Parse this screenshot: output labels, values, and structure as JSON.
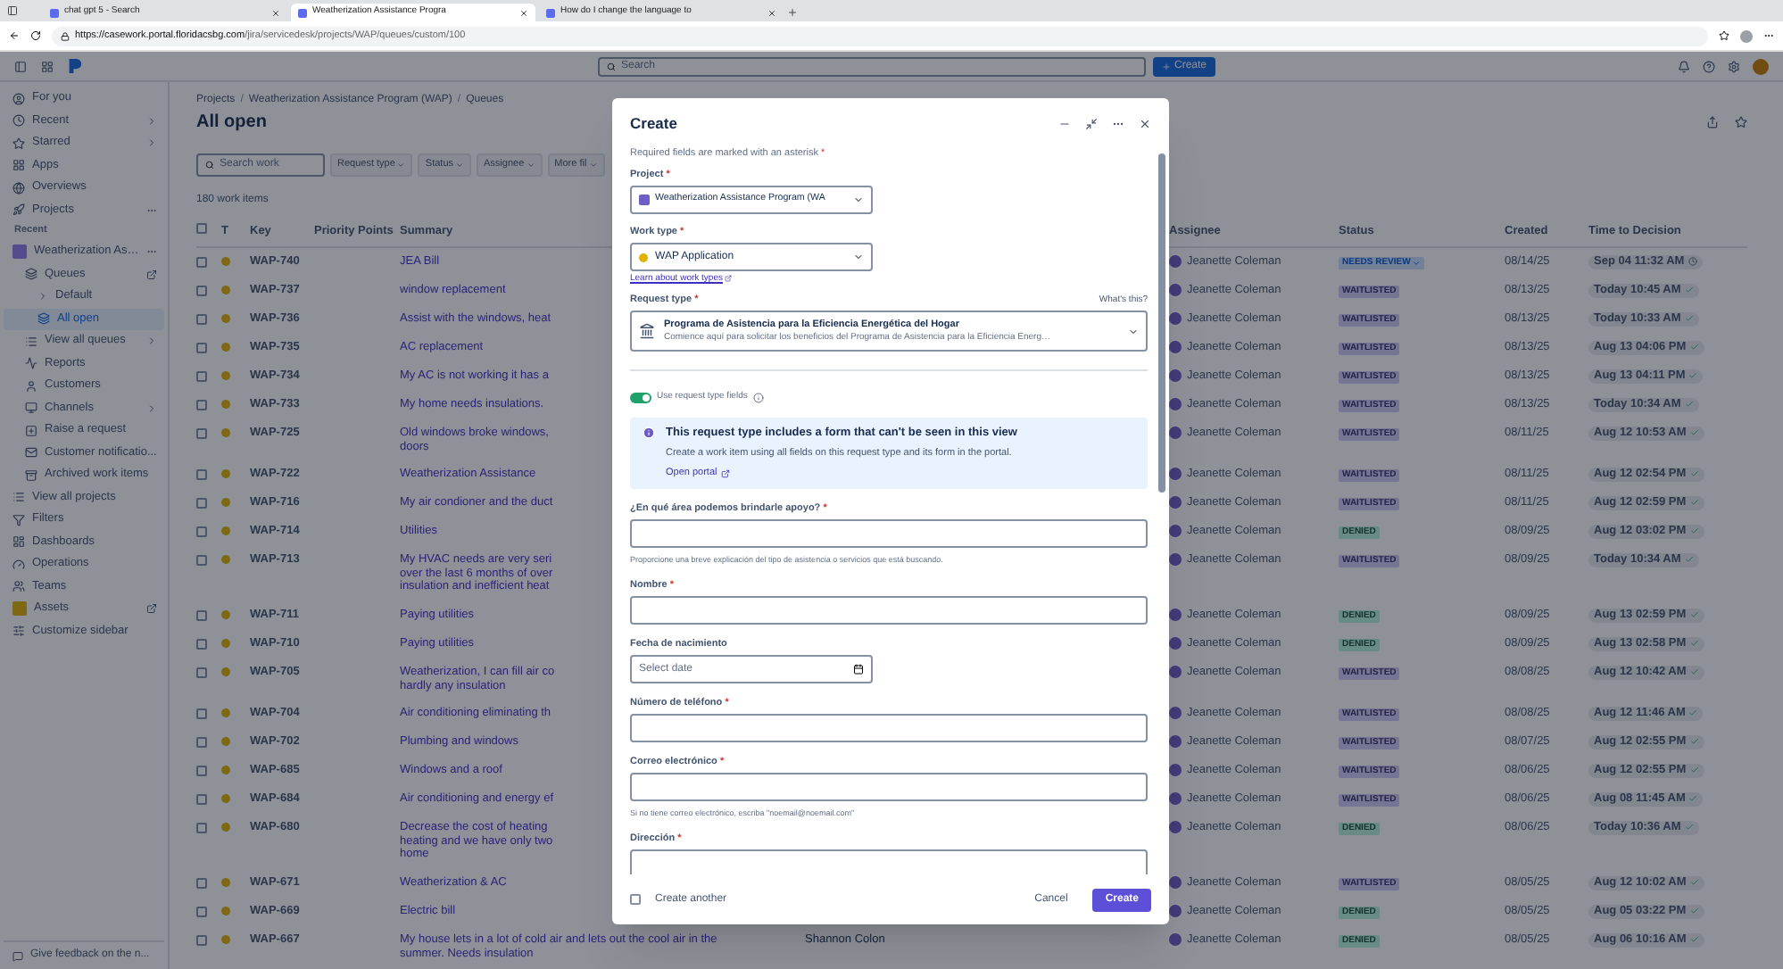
{
  "browser": {
    "tabs": [
      {
        "title": "chat gpt 5 - Search",
        "selected": false
      },
      {
        "title": "Weatherization Assistance Progra",
        "selected": true
      },
      {
        "title": "How do I change the language to",
        "selected": false
      }
    ],
    "url_host": "https://casework.portal.floridacsbg.com",
    "url_path": "/jira/servicedesk/projects/WAP/queues/custom/100"
  },
  "topnav": {
    "search_placeholder": "Search",
    "create_label": "Create"
  },
  "sidebar": {
    "items": [
      {
        "label": "For you",
        "kind": "nav",
        "selected": false
      },
      {
        "label": "Recent",
        "kind": "nav",
        "submenu": true,
        "selected": false
      },
      {
        "label": "Starred",
        "kind": "nav",
        "submenu": true,
        "selected": false
      },
      {
        "label": "Apps",
        "kind": "nav",
        "selected": false
      },
      {
        "label": "Overviews",
        "kind": "nav",
        "selected": false
      },
      {
        "label": "Projects",
        "kind": "nav",
        "more_menu": true,
        "selected": false
      },
      {
        "label": "Recent",
        "kind": "section"
      },
      {
        "label": "Weatherization As…",
        "kind": "project",
        "more_menu": true,
        "selected": false,
        "children": [
          {
            "label": "Queues",
            "kind": "nav",
            "external": true,
            "selected": false,
            "children": [
              {
                "label": "Default",
                "kind": "folder",
                "expanded": false,
                "selected": false
              },
              {
                "label": "All open",
                "kind": "nav",
                "selected": true
              }
            ]
          },
          {
            "label": "View all queues",
            "kind": "nav",
            "submenu": true,
            "selected": false
          },
          {
            "label": "Reports",
            "kind": "nav",
            "selected": false
          },
          {
            "label": "Customers",
            "kind": "nav",
            "selected": false
          },
          {
            "label": "Channels",
            "kind": "nav",
            "submenu": true,
            "selected": false
          },
          {
            "label": "Raise a request",
            "kind": "nav",
            "selected": false
          },
          {
            "label": "Customer notificatio...",
            "kind": "nav",
            "selected": false
          },
          {
            "label": "Archived work items",
            "kind": "nav",
            "selected": false
          }
        ]
      },
      {
        "label": "View all projects",
        "kind": "nav",
        "selected": false
      },
      {
        "label": "Filters",
        "kind": "nav",
        "selected": false
      },
      {
        "label": "Dashboards",
        "kind": "nav",
        "selected": false
      },
      {
        "label": "Operations",
        "kind": "nav",
        "selected": false
      },
      {
        "label": "Teams",
        "kind": "nav",
        "selected": false
      },
      {
        "label": "Assets",
        "kind": "app",
        "external": true,
        "selected": false
      },
      {
        "label": "Customize sidebar",
        "kind": "nav",
        "selected": false
      }
    ],
    "footer": "Give feedback on the n..."
  },
  "page": {
    "separator": "/",
    "breadcrumbs": [
      "Projects",
      "Weatherization Assistance Program (WAP)",
      "Queues"
    ],
    "title": "All open",
    "search_placeholder": "Search work",
    "filters": [
      "Request type",
      "Status",
      "Assignee",
      "More fil"
    ],
    "count": "180 work items"
  },
  "table": {
    "all_selected": false,
    "columns": [
      "T",
      "Key",
      "Priority Points",
      "Summary",
      "Assignee",
      "Status",
      "Created",
      "Time to Decision"
    ],
    "rows": [
      {
        "key": "WAP-740",
        "summary": [
          "JEA Bill"
        ],
        "assignee": "Jeanette Coleman",
        "status": {
          "label": "NEEDS REVIEW",
          "kind": "review"
        },
        "created": "08/14/25",
        "decision": {
          "label": "Sep 04 11:32 AM",
          "kind": "running"
        },
        "selected": false
      },
      {
        "key": "WAP-737",
        "summary": [
          "window replacement"
        ],
        "assignee": "Jeanette Coleman",
        "status": {
          "label": "WAITLISTED",
          "kind": "waitlisted"
        },
        "created": "08/13/25",
        "decision": {
          "label": "Today 10:45 AM",
          "kind": "met"
        },
        "selected": false
      },
      {
        "key": "WAP-736",
        "summary": [
          "Assist with the windows, heat"
        ],
        "assignee": "Jeanette Coleman",
        "status": {
          "label": "WAITLISTED",
          "kind": "waitlisted"
        },
        "created": "08/13/25",
        "decision": {
          "label": "Today 10:33 AM",
          "kind": "met"
        },
        "selected": false
      },
      {
        "key": "WAP-735",
        "summary": [
          "AC replacement"
        ],
        "assignee": "Jeanette Coleman",
        "status": {
          "label": "WAITLISTED",
          "kind": "waitlisted"
        },
        "created": "08/13/25",
        "decision": {
          "label": "Aug 13 04:06 PM",
          "kind": "met"
        },
        "selected": false
      },
      {
        "key": "WAP-734",
        "summary": [
          "My AC is not working it has a"
        ],
        "assignee": "Jeanette Coleman",
        "status": {
          "label": "WAITLISTED",
          "kind": "waitlisted"
        },
        "created": "08/13/25",
        "decision": {
          "label": "Aug 13 04:11 PM",
          "kind": "met"
        },
        "selected": false
      },
      {
        "key": "WAP-733",
        "summary": [
          "My home needs insulations."
        ],
        "assignee": "Jeanette Coleman",
        "status": {
          "label": "WAITLISTED",
          "kind": "waitlisted"
        },
        "created": "08/13/25",
        "decision": {
          "label": "Today 10:34 AM",
          "kind": "met"
        },
        "selected": false
      },
      {
        "key": "WAP-725",
        "summary": [
          "Old windows broke windows,",
          "doors"
        ],
        "assignee": "Jeanette Coleman",
        "status": {
          "label": "WAITLISTED",
          "kind": "waitlisted"
        },
        "created": "08/11/25",
        "decision": {
          "label": "Aug 12 10:53 AM",
          "kind": "met"
        },
        "selected": false
      },
      {
        "key": "WAP-722",
        "summary": [
          "Weatherization Assistance"
        ],
        "assignee": "Jeanette Coleman",
        "status": {
          "label": "WAITLISTED",
          "kind": "waitlisted"
        },
        "created": "08/11/25",
        "decision": {
          "label": "Aug 12 02:54 PM",
          "kind": "met"
        },
        "selected": false
      },
      {
        "key": "WAP-716",
        "summary": [
          "My air condioner and the duct"
        ],
        "assignee": "Jeanette Coleman",
        "status": {
          "label": "WAITLISTED",
          "kind": "waitlisted"
        },
        "created": "08/11/25",
        "decision": {
          "label": "Aug 12 02:59 PM",
          "kind": "met"
        },
        "selected": false
      },
      {
        "key": "WAP-714",
        "summary": [
          "Utilities"
        ],
        "assignee": "Jeanette Coleman",
        "status": {
          "label": "DENIED",
          "kind": "denied"
        },
        "created": "08/09/25",
        "decision": {
          "label": "Aug 12 03:02 PM",
          "kind": "met"
        },
        "selected": false
      },
      {
        "key": "WAP-713",
        "summary": [
          "My HVAC needs are very seri",
          "over the last 6 months of over",
          "insulation and inefficient heat"
        ],
        "assignee": "Jeanette Coleman",
        "status": {
          "label": "WAITLISTED",
          "kind": "waitlisted"
        },
        "created": "08/09/25",
        "decision": {
          "label": "Today 10:34 AM",
          "kind": "met"
        },
        "selected": false
      },
      {
        "key": "WAP-711",
        "summary": [
          "Paying utilities"
        ],
        "assignee": "Jeanette Coleman",
        "status": {
          "label": "DENIED",
          "kind": "denied"
        },
        "created": "08/09/25",
        "decision": {
          "label": "Aug 13 02:59 PM",
          "kind": "met"
        },
        "selected": false
      },
      {
        "key": "WAP-710",
        "summary": [
          "Paying utilities"
        ],
        "assignee": "Jeanette Coleman",
        "status": {
          "label": "DENIED",
          "kind": "denied"
        },
        "created": "08/09/25",
        "decision": {
          "label": "Aug 13 02:58 PM",
          "kind": "met"
        },
        "selected": false
      },
      {
        "key": "WAP-705",
        "summary": [
          "Weatherization, I can fill air co",
          "hardly any insulation"
        ],
        "assignee": "Jeanette Coleman",
        "status": {
          "label": "WAITLISTED",
          "kind": "waitlisted"
        },
        "created": "08/08/25",
        "decision": {
          "label": "Aug 12 10:42 AM",
          "kind": "met"
        },
        "selected": false
      },
      {
        "key": "WAP-704",
        "summary": [
          "Air conditioning eliminating th"
        ],
        "assignee": "Jeanette Coleman",
        "status": {
          "label": "WAITLISTED",
          "kind": "waitlisted"
        },
        "created": "08/08/25",
        "decision": {
          "label": "Aug 12 11:46 AM",
          "kind": "met"
        },
        "selected": false
      },
      {
        "key": "WAP-702",
        "summary": [
          "Plumbing and windows"
        ],
        "assignee": "Jeanette Coleman",
        "status": {
          "label": "WAITLISTED",
          "kind": "waitlisted"
        },
        "created": "08/07/25",
        "decision": {
          "label": "Aug 12 02:55 PM",
          "kind": "met"
        },
        "selected": false
      },
      {
        "key": "WAP-685",
        "summary": [
          "Windows and a roof"
        ],
        "assignee": "Jeanette Coleman",
        "status": {
          "label": "WAITLISTED",
          "kind": "waitlisted"
        },
        "created": "08/06/25",
        "decision": {
          "label": "Aug 12 02:55 PM",
          "kind": "met"
        },
        "selected": false
      },
      {
        "key": "WAP-684",
        "summary": [
          "Air conditioning and energy ef"
        ],
        "assignee": "Jeanette Coleman",
        "status": {
          "label": "WAITLISTED",
          "kind": "waitlisted"
        },
        "created": "08/06/25",
        "decision": {
          "label": "Aug 08 11:45 AM",
          "kind": "met"
        },
        "selected": false
      },
      {
        "key": "WAP-680",
        "summary": [
          "Decrease the cost of heating",
          "heating and we have only two",
          "home"
        ],
        "assignee": "Jeanette Coleman",
        "status": {
          "label": "DENIED",
          "kind": "denied"
        },
        "created": "08/06/25",
        "decision": {
          "label": "Today 10:36 AM",
          "kind": "met"
        },
        "selected": false
      },
      {
        "key": "WAP-671",
        "summary": [
          "Weatherization & AC"
        ],
        "assignee": "Jeanette Coleman",
        "status": {
          "label": "WAITLISTED",
          "kind": "waitlisted"
        },
        "created": "08/05/25",
        "decision": {
          "label": "Aug 12 10:02 AM",
          "kind": "met"
        },
        "selected": false
      },
      {
        "key": "WAP-669",
        "summary": [
          "Electric bill"
        ],
        "assignee": "Jeanette Coleman",
        "status": {
          "label": "DENIED",
          "kind": "denied"
        },
        "created": "08/05/25",
        "decision": {
          "label": "Aug 05 03:22 PM",
          "kind": "met"
        },
        "selected": false
      },
      {
        "key": "WAP-667",
        "summary": [
          "My house lets in a lot of cold air and lets out the cool air in the",
          "summer. Needs insulation"
        ],
        "reporter": "Shannon Colon",
        "assignee": "Jeanette Coleman",
        "status": {
          "label": "DENIED",
          "kind": "denied"
        },
        "created": "08/05/25",
        "decision": {
          "label": "Aug 06 10:16 AM",
          "kind": "met"
        },
        "selected": false
      }
    ]
  },
  "modal": {
    "title": "Create",
    "required_note": "Required fields are marked with an asterisk",
    "asterisk": "*",
    "project": {
      "label": "Project",
      "required": true,
      "value": "Weatherization Assistance Program (WA"
    },
    "work_type": {
      "label": "Work type",
      "required": true,
      "value": "WAP Application",
      "link": "Learn about work types"
    },
    "request_type": {
      "label": "Request type",
      "required": true,
      "help": "What's this?",
      "title": "Programa de Asistencia para la Eficiencia Energética del Hogar",
      "description": "Comience aquí para solicitar los beneficios del Programa de Asistencia para la Eficiencia Energ…"
    },
    "toggle": {
      "label": "Use request type fields",
      "on": true
    },
    "notice": {
      "title": "This request type includes a form that can't be seen in this view",
      "body": "Create a work item using all fields on this request type and its form in the portal.",
      "link": "Open portal"
    },
    "fields": [
      {
        "label": "¿En qué área podemos brindarle apoyo?",
        "required": true,
        "kind": "text",
        "helper": "Proporcione una breve explicación del tipo de asistencia o servicios que está buscando."
      },
      {
        "label": "Nombre",
        "required": true,
        "kind": "text"
      },
      {
        "label": "Fecha de nacimiento",
        "required": false,
        "kind": "date",
        "placeholder": "Select date"
      },
      {
        "label": "Número de teléfono",
        "required": true,
        "kind": "text"
      },
      {
        "label": "Correo electrónico",
        "required": true,
        "kind": "text",
        "helper": "Si no tiene correo electrónico, escriba \"noemail@noemail.com\""
      },
      {
        "label": "Dirección",
        "required": true,
        "kind": "text"
      }
    ],
    "create_another": {
      "label": "Create another",
      "checked": false
    },
    "buttons": {
      "cancel": "Cancel",
      "create": "Create"
    }
  }
}
